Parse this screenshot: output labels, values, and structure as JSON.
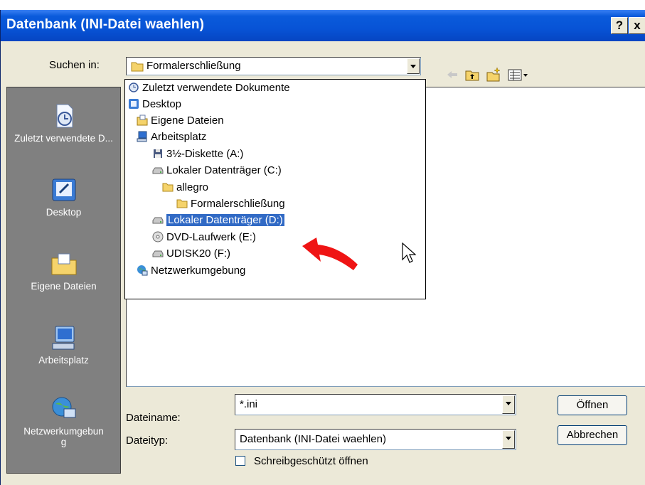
{
  "window": {
    "title": "Datenbank (INI-Datei waehlen)",
    "help_label": "?",
    "close_label": "x"
  },
  "lookin": {
    "label": "Suchen in:",
    "value": "Formalerschließung"
  },
  "places": [
    {
      "label": "Zuletzt verwendete D...",
      "icon": "recent-documents-icon"
    },
    {
      "label": "Desktop",
      "icon": "desktop-icon"
    },
    {
      "label": "Eigene Dateien",
      "icon": "my-documents-icon"
    },
    {
      "label": "Arbeitsplatz",
      "icon": "my-computer-icon"
    },
    {
      "label": "Netzwerkumgebung",
      "icon": "network-icon"
    }
  ],
  "dropdown": [
    {
      "label": "Zuletzt verwendete Dokumente",
      "icon": "recent-documents-icon",
      "level": 0
    },
    {
      "label": "Desktop",
      "icon": "desktop-icon",
      "level": 0
    },
    {
      "label": "Eigene Dateien",
      "icon": "my-documents-icon",
      "level": 1
    },
    {
      "label": "Arbeitsplatz",
      "icon": "my-computer-icon",
      "level": 1
    },
    {
      "label": "3½-Diskette (A:)",
      "icon": "floppy-icon",
      "level": 2
    },
    {
      "label": "Lokaler Datenträger (C:)",
      "icon": "drive-icon",
      "level": 2
    },
    {
      "label": "allegro",
      "icon": "folder-icon",
      "level": 3
    },
    {
      "label": "Formalerschließung",
      "icon": "folder-icon",
      "level": 4
    },
    {
      "label": "Lokaler Datenträger (D:)",
      "icon": "drive-icon",
      "level": 2,
      "selected": true
    },
    {
      "label": "DVD-Laufwerk (E:)",
      "icon": "dvd-icon",
      "level": 2
    },
    {
      "label": "UDISK20 (F:)",
      "icon": "drive-icon",
      "level": 2
    },
    {
      "label": "Netzwerkumgebung",
      "icon": "network-icon",
      "level": 1
    }
  ],
  "filename": {
    "label": "Dateiname:",
    "value": "*.ini"
  },
  "filetype": {
    "label": "Dateityp:",
    "value": "Datenbank (INI-Datei waehlen)"
  },
  "readonly": {
    "label": "Schreibgeschützt öffnen"
  },
  "buttons": {
    "open": "Öffnen",
    "cancel": "Abbrechen"
  },
  "colors": {
    "titlebar": "#0753d6",
    "selection": "#316ac5",
    "dialog_bg": "#ece9d8",
    "places_bg": "#808080",
    "annotation": "#ee0000"
  }
}
